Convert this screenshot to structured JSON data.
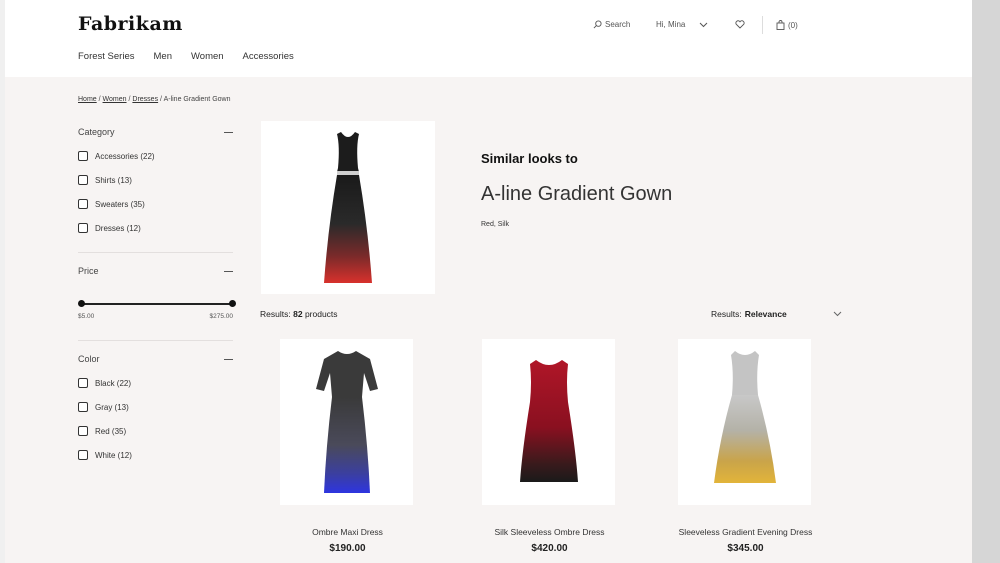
{
  "brand": "Fabrikam",
  "nav": [
    "Forest Series",
    "Men",
    "Women",
    "Accessories"
  ],
  "utility": {
    "search_label": "Search",
    "greeting": "Hi, Mina",
    "cart_count": "(0)"
  },
  "breadcrumb": {
    "items": [
      "Home",
      "Women",
      "Dresses"
    ],
    "current": "A-line Gradient Gown",
    "separator": "/"
  },
  "filters": {
    "category": {
      "title": "Category",
      "options": [
        "Accessories (22)",
        "Shirts (13)",
        "Sweaters (35)",
        "Dresses (12)"
      ]
    },
    "price": {
      "title": "Price",
      "min_label": "$5.00",
      "max_label": "$275.00"
    },
    "color": {
      "title": "Color",
      "options": [
        "Black (22)",
        "Gray (13)",
        "Red (35)",
        "White (12)"
      ]
    }
  },
  "hero": {
    "heading": "Similar looks to",
    "product_name": "A-line Gradient Gown",
    "attributes": "Red, Silk"
  },
  "results": {
    "prefix": "Results:",
    "count": "82",
    "suffix": "products",
    "sort_prefix": "Results:",
    "sort_value": "Relevance"
  },
  "products": [
    {
      "name": "Ombre Maxi Dress",
      "price": "$190.00"
    },
    {
      "name": "Silk Sleeveless Ombre Dress",
      "price": "$420.00"
    },
    {
      "name": "Sleeveless Gradient Evening Dress",
      "price": "$345.00"
    }
  ],
  "colors": {
    "page_bg": "#f7f4f3",
    "header_bg": "#ffffff",
    "text": "#222222"
  }
}
